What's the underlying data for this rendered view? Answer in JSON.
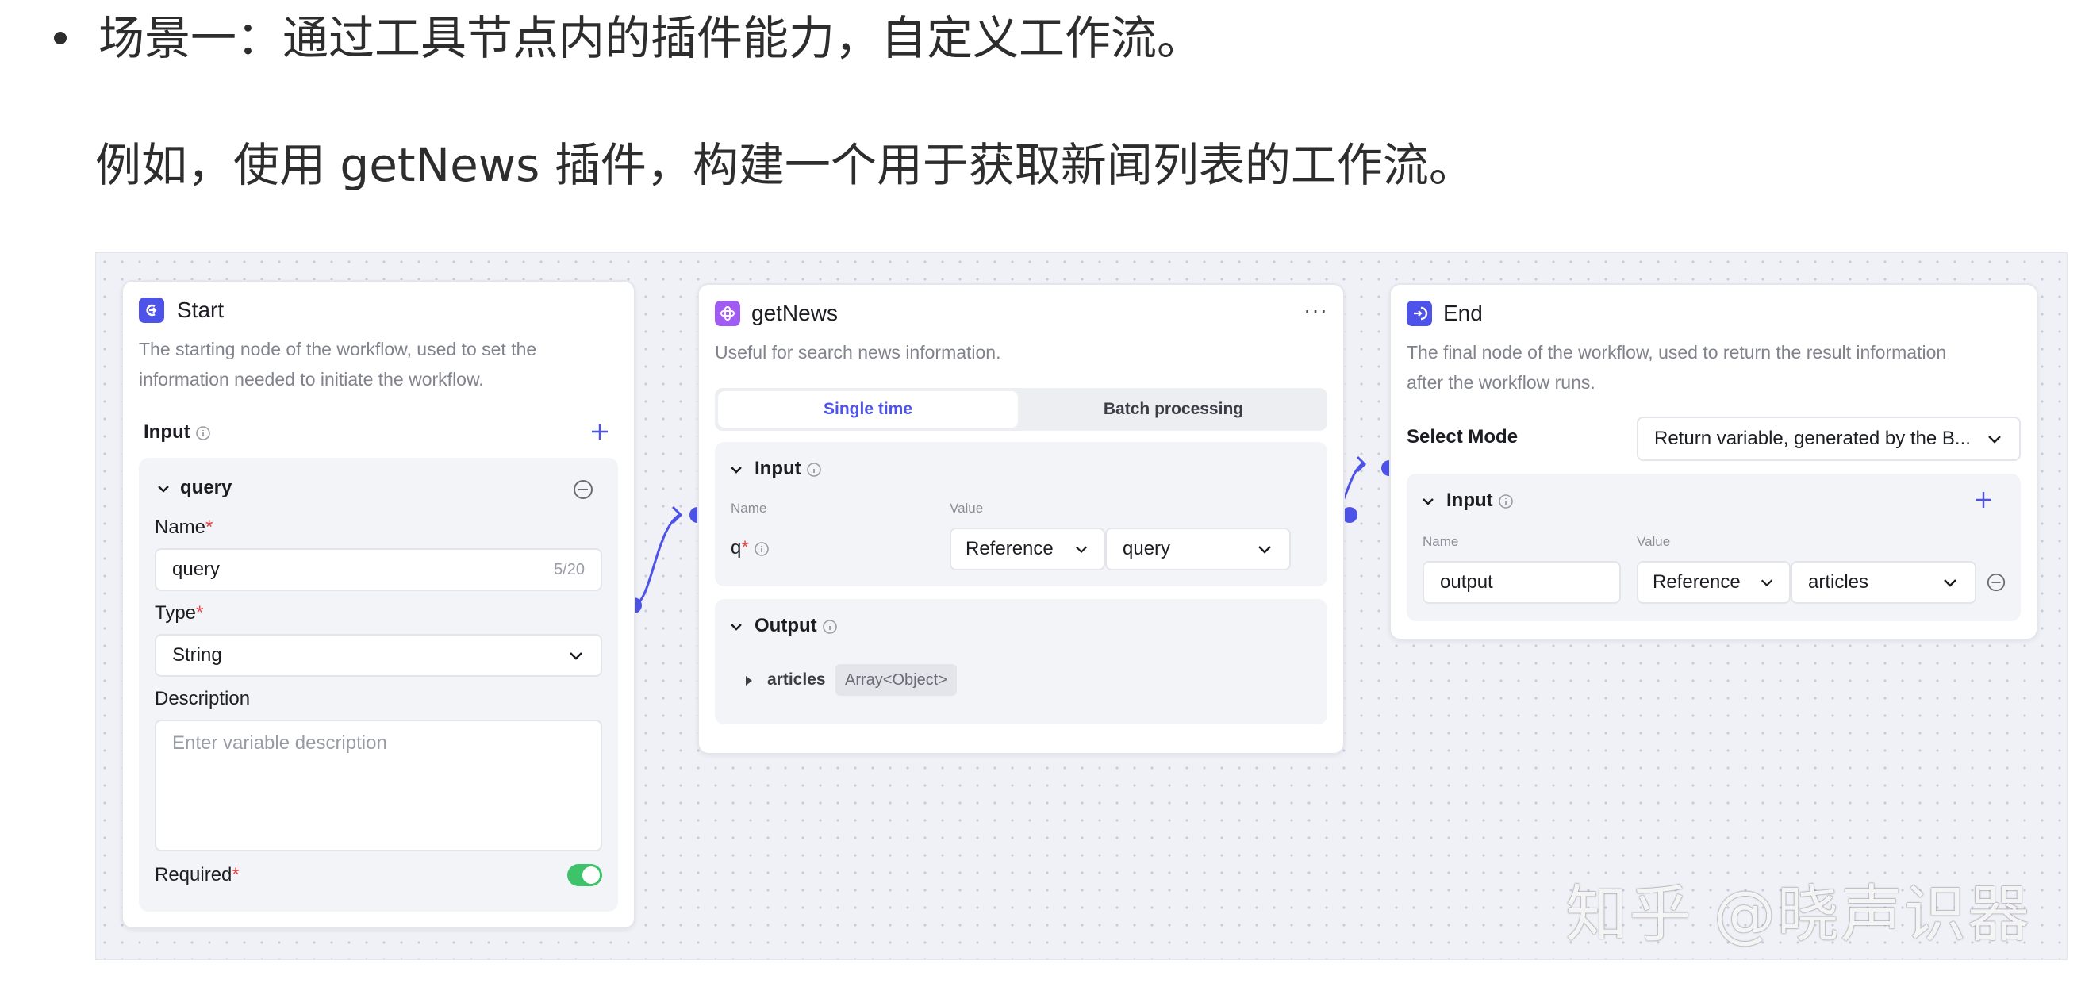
{
  "article": {
    "bullet_text": "场景一：通过工具节点内的插件能力，自定义工作流。",
    "example_text": "例如，使用 getNews 插件，构建一个用于获取新闻列表的工作流。"
  },
  "start_node": {
    "title": "Start",
    "description_line1": "The starting node of the workflow, used to set the",
    "description_line2": "information needed to initiate the workflow.",
    "input_label": "Input",
    "variable": {
      "name": "query",
      "name_label": "Name",
      "name_value": "query",
      "name_count": "5/20",
      "type_label": "Type",
      "type_value": "String",
      "description_label": "Description",
      "description_placeholder": "Enter variable description",
      "required_label": "Required",
      "required_on": true
    }
  },
  "tool_node": {
    "title": "getNews",
    "description": "Useful for search news information.",
    "more_label": "···",
    "tabs": [
      {
        "label": "Single time",
        "active": true
      },
      {
        "label": "Batch processing",
        "active": false
      }
    ],
    "input_label": "Input",
    "col_name": "Name",
    "col_value": "Value",
    "param_name": "q",
    "param_mode": "Reference",
    "param_value": "query",
    "output_label": "Output",
    "output_name": "articles",
    "output_type": "Array<Object>"
  },
  "end_node": {
    "title": "End",
    "description_line1": "The final node of the workflow, used to return the result information",
    "description_line2": "after the workflow runs.",
    "select_mode_label": "Select Mode",
    "select_mode_value": "Return variable, generated by the B...",
    "input_label": "Input",
    "col_name": "Name",
    "col_value": "Value",
    "param_name": "output",
    "param_mode": "Reference",
    "param_value": "articles"
  },
  "watermark": "知乎 @晓声识器",
  "colors": {
    "accent": "#4d53e8",
    "start_icon": "#4d53e8",
    "tool_icon": "#a05cf0",
    "end_icon": "#4d53e8",
    "toggle_on": "#3ec26a",
    "canvas_bg": "#f0f1f6"
  }
}
